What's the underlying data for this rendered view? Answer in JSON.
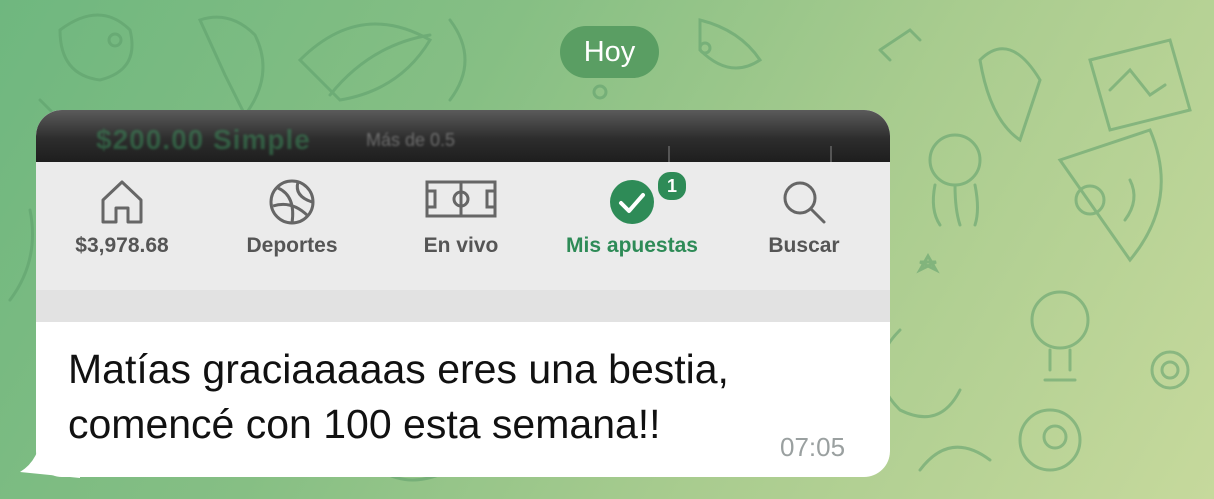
{
  "date_separator": "Hoy",
  "screenshot": {
    "tabs": [
      {
        "label": "$3,978.68",
        "icon": "home-icon",
        "active": false
      },
      {
        "label": "Deportes",
        "icon": "ball-icon",
        "active": false
      },
      {
        "label": "En vivo",
        "icon": "field-icon",
        "active": false
      },
      {
        "label": "Mis apuestas",
        "icon": "check-circle-icon",
        "active": true,
        "badge": "1"
      },
      {
        "label": "Buscar",
        "icon": "search-icon",
        "active": false
      }
    ],
    "accent": "#2e8b57"
  },
  "message": {
    "line1": "Matías graciaaaaas eres una bestia,",
    "line2": "comencé con 100 esta semana!!",
    "time": "07:05"
  }
}
